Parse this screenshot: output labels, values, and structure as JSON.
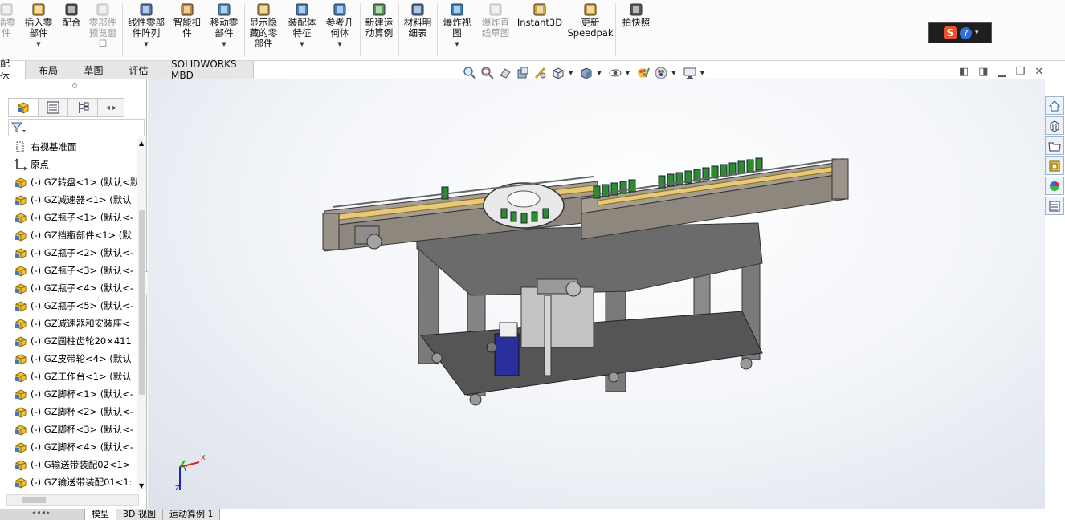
{
  "ribbon": {
    "buttons": [
      {
        "id": "insert-component-partial",
        "label": "插零\n件",
        "disabled": true,
        "dropdown": false
      },
      {
        "id": "insert-component",
        "label": "插入零\n部件",
        "disabled": false,
        "dropdown": true
      },
      {
        "id": "mate",
        "label": "配合",
        "disabled": false,
        "dropdown": false
      },
      {
        "id": "component-preview",
        "label": "零部件\n预览窗\n口",
        "disabled": true,
        "dropdown": false
      },
      {
        "id": "linear-pattern",
        "label": "线性零部\n件阵列",
        "disabled": false,
        "dropdown": true
      },
      {
        "id": "smart-fasteners",
        "label": "智能扣\n件",
        "disabled": false,
        "dropdown": false
      },
      {
        "id": "move-component",
        "label": "移动零\n部件",
        "disabled": false,
        "dropdown": true
      },
      {
        "id": "show-hidden",
        "label": "显示隐\n藏的零\n部件",
        "disabled": false,
        "dropdown": false
      },
      {
        "id": "assembly-features",
        "label": "装配体\n特征",
        "disabled": false,
        "dropdown": true
      },
      {
        "id": "reference-geometry",
        "label": "参考几\n何体",
        "disabled": false,
        "dropdown": true
      },
      {
        "id": "new-motion-study",
        "label": "新建运\n动算例",
        "disabled": false,
        "dropdown": false
      },
      {
        "id": "bom",
        "label": "材料明\n细表",
        "disabled": false,
        "dropdown": false
      },
      {
        "id": "exploded-view",
        "label": "爆炸视\n图",
        "disabled": false,
        "dropdown": true
      },
      {
        "id": "explode-line-sketch",
        "label": "爆炸直\n线草图",
        "disabled": true,
        "dropdown": false
      },
      {
        "id": "instant3d",
        "label": "Instant3D",
        "disabled": false,
        "dropdown": false
      },
      {
        "id": "update-speedpak",
        "label": "更新\nSpeedpak",
        "disabled": false,
        "dropdown": false
      },
      {
        "id": "snapshot",
        "label": "拍快照",
        "disabled": false,
        "dropdown": false
      }
    ]
  },
  "tabs": [
    {
      "label": "配体",
      "active": true
    },
    {
      "label": "布局",
      "active": false
    },
    {
      "label": "草图",
      "active": false
    },
    {
      "label": "评估",
      "active": false
    },
    {
      "label": "SOLIDWORKS MBD",
      "active": false
    }
  ],
  "tree": {
    "items": [
      {
        "label": "右视基准面",
        "icon": "plane-icon"
      },
      {
        "label": "原点",
        "icon": "origin-icon"
      },
      {
        "label": "(-) GZ转盘<1> (默认<默",
        "icon": "part-icon"
      },
      {
        "label": "(-) GZ减速器<1> (默认",
        "icon": "part-icon"
      },
      {
        "label": "(-) GZ瓶子<1> (默认<-",
        "icon": "part-icon"
      },
      {
        "label": "(-) GZ挡瓶部件<1> (默",
        "icon": "part-icon"
      },
      {
        "label": "(-) GZ瓶子<2> (默认<-",
        "icon": "part-icon"
      },
      {
        "label": "(-) GZ瓶子<3> (默认<-",
        "icon": "part-icon"
      },
      {
        "label": "(-) GZ瓶子<4> (默认<-",
        "icon": "part-icon"
      },
      {
        "label": "(-) GZ瓶子<5> (默认<-",
        "icon": "part-icon"
      },
      {
        "label": "(-) GZ减速器和安装座<",
        "icon": "part-icon"
      },
      {
        "label": "(-) GZ圆柱齿轮20×411",
        "icon": "part-icon"
      },
      {
        "label": "(-) GZ皮带轮<4> (默认",
        "icon": "part-icon"
      },
      {
        "label": "(-) GZ工作台<1> (默认",
        "icon": "part-icon"
      },
      {
        "label": "(-) GZ脚杯<1> (默认<-",
        "icon": "part-icon"
      },
      {
        "label": "(-) GZ脚杯<2> (默认<-",
        "icon": "part-icon"
      },
      {
        "label": "(-) GZ脚杯<3> (默认<-",
        "icon": "part-icon"
      },
      {
        "label": "(-) GZ脚杯<4> (默认<-",
        "icon": "part-icon"
      },
      {
        "label": "(-) G输送带装配02<1>",
        "icon": "part-icon"
      },
      {
        "label": "(-) GZ输送带装配01<1:",
        "icon": "part-icon"
      }
    ]
  },
  "bottom_tabs": [
    {
      "label": "模型",
      "active": true
    },
    {
      "label": "3D 视图",
      "active": false
    },
    {
      "label": "运动算例 1",
      "active": false
    }
  ],
  "triad": {
    "x": "X",
    "y": "Y",
    "z": "Z"
  },
  "colors": {
    "accent": "#1f5fb4",
    "part_yellow": "#e6b422",
    "bottle_green": "#2e8b2e"
  }
}
